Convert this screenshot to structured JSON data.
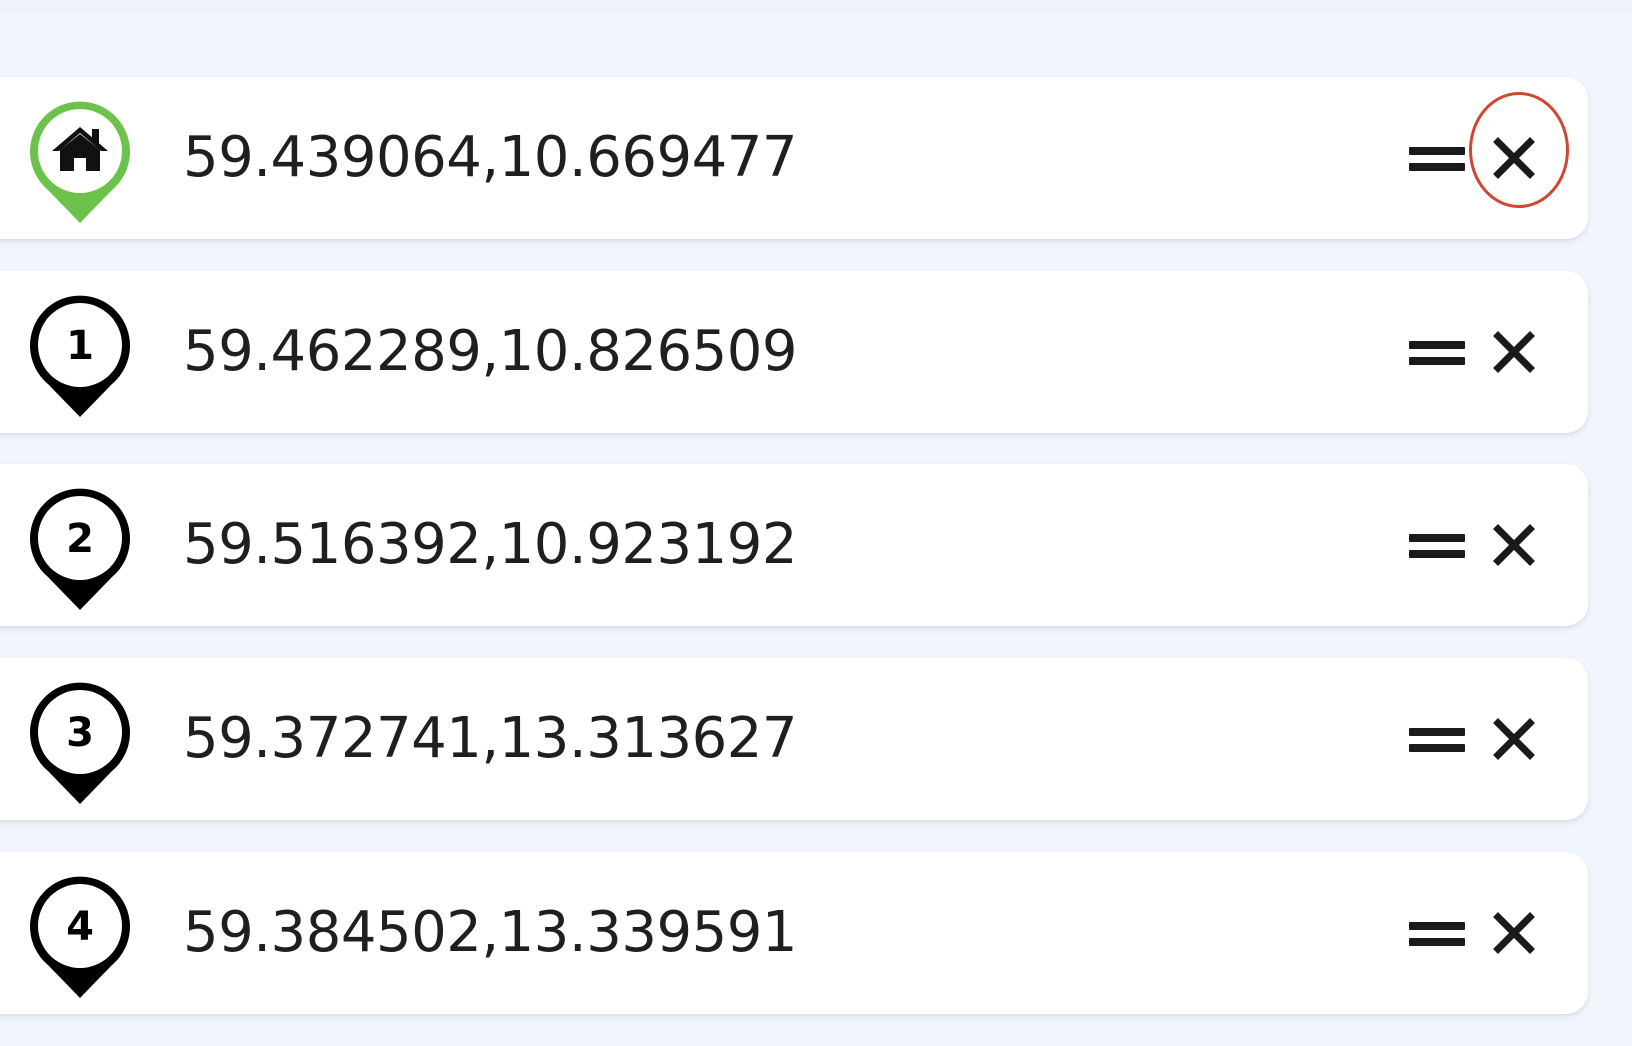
{
  "waypoints": [
    {
      "marker": "home",
      "marker_icon": "home-marker-icon",
      "color": "#6cc24a",
      "coordinates": "59.439064,10.669477"
    },
    {
      "marker": "1",
      "marker_icon": "numbered-marker-icon",
      "color": "#000000",
      "coordinates": "59.462289,10.826509"
    },
    {
      "marker": "2",
      "marker_icon": "numbered-marker-icon",
      "color": "#000000",
      "coordinates": "59.516392,10.923192"
    },
    {
      "marker": "3",
      "marker_icon": "numbered-marker-icon",
      "color": "#000000",
      "coordinates": "59.372741,13.313627"
    },
    {
      "marker": "4",
      "marker_icon": "numbered-marker-icon",
      "color": "#000000",
      "coordinates": "59.384502,13.339591"
    }
  ],
  "icons": {
    "drag": "drag-handle-icon",
    "remove": "close-icon"
  },
  "colors": {
    "background": "#f1f5fd",
    "card": "#ffffff",
    "highlight": "#cf4631"
  }
}
